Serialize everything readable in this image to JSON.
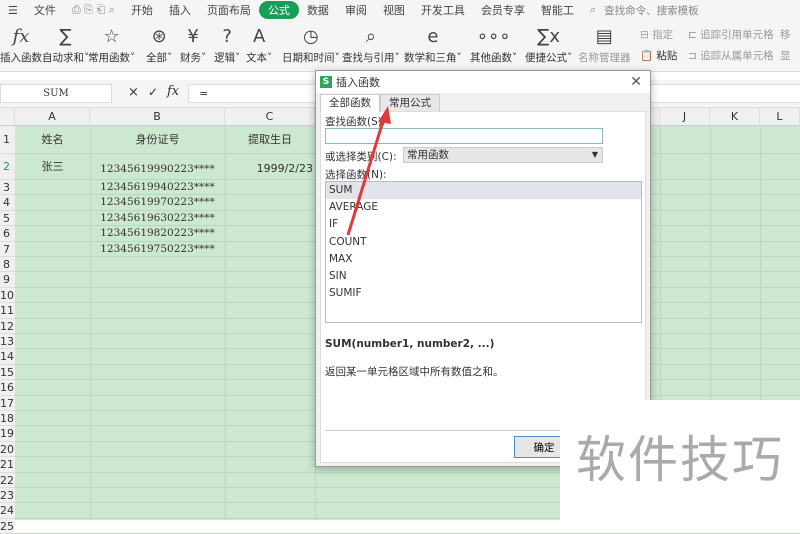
{
  "menu": {
    "file": "文件",
    "tabs": [
      "开始",
      "插入",
      "页面布局",
      "公式",
      "数据",
      "审阅",
      "视图",
      "开发工具",
      "会员专享",
      "智能工"
    ],
    "active_tab": "公式",
    "search_placeholder": "查找命令、搜索模板"
  },
  "ribbon": {
    "buttons": [
      {
        "icon": "fx",
        "label": "插入函数"
      },
      {
        "icon": "∑",
        "label": "自动求和˅"
      },
      {
        "icon": "☆",
        "label": "常用函数˅"
      },
      {
        "icon": "⊛",
        "label": "全部˅"
      },
      {
        "icon": "¥",
        "label": "财务˅"
      },
      {
        "icon": "?",
        "label": "逻辑˅"
      },
      {
        "icon": "A",
        "label": "文本˅"
      },
      {
        "icon": "◷",
        "label": "日期和时间˅"
      },
      {
        "icon": "⌕",
        "label": "查找与引用˅"
      },
      {
        "icon": "e",
        "label": "数学和三角˅"
      },
      {
        "icon": "∘∘∘",
        "label": "其他函数˅"
      },
      {
        "icon": "∑x",
        "label": "便捷公式˅"
      },
      {
        "icon": "▤",
        "label": "名称管理器"
      }
    ],
    "specify": "指定",
    "paste": "粘贴",
    "trace_precedents": "追踪引用单元格",
    "trace_dependents": "追踪从属单元格",
    "move": "移",
    "show": "显"
  },
  "formula_bar": {
    "name_box": "SUM",
    "cancel": "×",
    "enter": "✓",
    "fx": "fx",
    "content": "="
  },
  "sheet": {
    "columns": [
      "A",
      "B",
      "C",
      "J",
      "K",
      "L"
    ],
    "rows": [
      "1",
      "2",
      "3",
      "4",
      "5",
      "6",
      "7",
      "8",
      "9",
      "10",
      "11",
      "12",
      "13",
      "14",
      "15",
      "16",
      "17",
      "18",
      "19",
      "20",
      "21",
      "22",
      "23",
      "24",
      "25"
    ],
    "header": {
      "a": "姓名",
      "b": "身份证号",
      "c": "提取生日"
    },
    "name": "张三",
    "birthday": "1999/2/23",
    "ids": [
      "12345619990223****",
      "12345619940223****",
      "12345619970223****",
      "12345619630223****",
      "12345619820223****",
      "12345619750223****"
    ]
  },
  "dialog": {
    "title": "插入函数",
    "tabs": [
      "全部函数",
      "常用公式"
    ],
    "search_label": "查找函数(S):",
    "search_value": "",
    "category_label": "或选择类别(C):",
    "category": "常用函数",
    "select_label": "选择函数(N):",
    "functions": [
      "SUM",
      "AVERAGE",
      "IF",
      "COUNT",
      "MAX",
      "SIN",
      "SUMIF"
    ],
    "selected": "SUM",
    "signature": "SUM(number1, number2, ...)",
    "description": "返回某一单元格区域中所有数值之和。",
    "ok": "确定"
  },
  "watermark": "软件技巧",
  "colors": {
    "accent": "#1a9d5a",
    "grid": "#cde8d0",
    "arrow": "#e03a3a"
  }
}
